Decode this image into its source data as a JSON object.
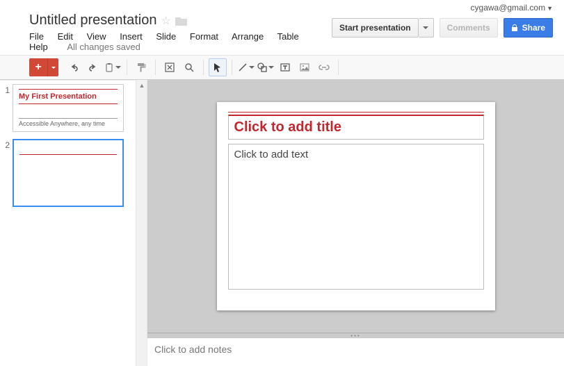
{
  "account": {
    "email": "cygawa@gmail.com"
  },
  "document": {
    "title": "Untitled presentation"
  },
  "menus": [
    "File",
    "Edit",
    "View",
    "Insert",
    "Slide",
    "Format",
    "Arrange",
    "Table",
    "Help"
  ],
  "status": "All changes saved",
  "buttons": {
    "start": "Start presentation",
    "comments": "Comments",
    "share": "Share"
  },
  "thumbnails": [
    {
      "num": "1",
      "title": "My First Presentation",
      "subtitle": "Accessible Anywhere, any time",
      "selected": false
    },
    {
      "num": "2",
      "title": "",
      "subtitle": "",
      "selected": true
    }
  ],
  "editor": {
    "titlePlaceholder": "Click to add title",
    "bodyPlaceholder": "Click to add text",
    "notesPlaceholder": "Click to add notes"
  }
}
